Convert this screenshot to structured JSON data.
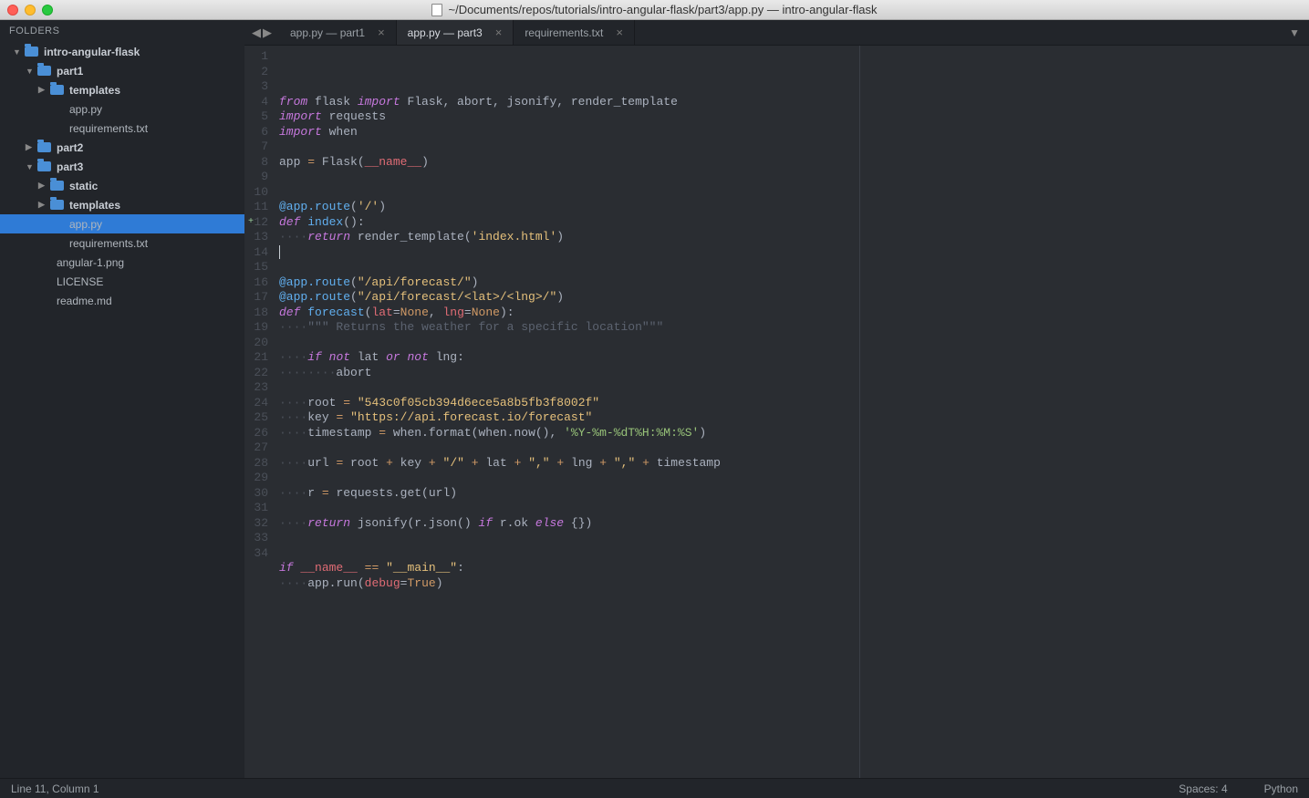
{
  "window": {
    "title": "~/Documents/repos/tutorials/intro-angular-flask/part3/app.py — intro-angular-flask"
  },
  "sidebar": {
    "header": "FOLDERS",
    "tree": [
      {
        "name": "intro-angular-flask",
        "type": "folder",
        "indent": 0,
        "open": true
      },
      {
        "name": "part1",
        "type": "folder",
        "indent": 1,
        "open": true
      },
      {
        "name": "templates",
        "type": "folder",
        "indent": 2,
        "open": false
      },
      {
        "name": "app.py",
        "type": "file",
        "indent": 2
      },
      {
        "name": "requirements.txt",
        "type": "file",
        "indent": 2
      },
      {
        "name": "part2",
        "type": "folder",
        "indent": 1,
        "open": false
      },
      {
        "name": "part3",
        "type": "folder",
        "indent": 1,
        "open": true
      },
      {
        "name": "static",
        "type": "folder",
        "indent": 2,
        "open": false
      },
      {
        "name": "templates",
        "type": "folder",
        "indent": 2,
        "open": false
      },
      {
        "name": "app.py",
        "type": "file",
        "indent": 2,
        "selected": true
      },
      {
        "name": "requirements.txt",
        "type": "file",
        "indent": 2
      },
      {
        "name": "angular-1.png",
        "type": "file",
        "indent": 1
      },
      {
        "name": "LICENSE",
        "type": "file",
        "indent": 1
      },
      {
        "name": "readme.md",
        "type": "file",
        "indent": 1
      }
    ]
  },
  "tabs": [
    {
      "label": "app.py — part1",
      "active": false
    },
    {
      "label": "app.py — part3",
      "active": true
    },
    {
      "label": "requirements.txt",
      "active": false
    }
  ],
  "code": {
    "lines": [
      [
        {
          "t": "from",
          "c": "key"
        },
        {
          "t": " flask "
        },
        {
          "t": "import",
          "c": "key"
        },
        {
          "t": " Flask, abort, jsonify, render_template"
        }
      ],
      [
        {
          "t": "import",
          "c": "key"
        },
        {
          "t": " requests"
        }
      ],
      [
        {
          "t": "import",
          "c": "key"
        },
        {
          "t": " when"
        }
      ],
      [],
      [
        {
          "t": "app "
        },
        {
          "t": "=",
          "c": "op"
        },
        {
          "t": " Flask("
        },
        {
          "t": "__name__",
          "c": "var"
        },
        {
          "t": ")"
        }
      ],
      [],
      [],
      [
        {
          "t": "@app.route",
          "c": "dec"
        },
        {
          "t": "("
        },
        {
          "t": "'/'",
          "c": "str"
        },
        {
          "t": ")"
        }
      ],
      [
        {
          "t": "def",
          "c": "key"
        },
        {
          "t": " "
        },
        {
          "t": "index",
          "c": "def"
        },
        {
          "t": "():"
        }
      ],
      [
        {
          "t": "····",
          "c": "dot"
        },
        {
          "t": "return",
          "c": "key"
        },
        {
          "t": " render_template("
        },
        {
          "t": "'index.html'",
          "c": "str"
        },
        {
          "t": ")"
        }
      ],
      [
        {
          "cursor": true
        }
      ],
      [],
      [
        {
          "t": "@app.route",
          "c": "dec"
        },
        {
          "t": "("
        },
        {
          "t": "\"/api/forecast/\"",
          "c": "str"
        },
        {
          "t": ")"
        }
      ],
      [
        {
          "t": "@app.route",
          "c": "dec"
        },
        {
          "t": "("
        },
        {
          "t": "\"/api/forecast/<lat>/<lng>/\"",
          "c": "str"
        },
        {
          "t": ")"
        }
      ],
      [
        {
          "t": "def",
          "c": "key"
        },
        {
          "t": " "
        },
        {
          "t": "forecast",
          "c": "def"
        },
        {
          "t": "("
        },
        {
          "t": "lat",
          "c": "var"
        },
        {
          "t": "="
        },
        {
          "t": "None",
          "c": "num"
        },
        {
          "t": ", "
        },
        {
          "t": "lng",
          "c": "var"
        },
        {
          "t": "="
        },
        {
          "t": "None",
          "c": "num"
        },
        {
          "t": "):"
        }
      ],
      [
        {
          "t": "····",
          "c": "dot"
        },
        {
          "t": "\"\"\" Returns the weather for a specific location\"\"\"",
          "c": "cmt"
        }
      ],
      [],
      [
        {
          "t": "····",
          "c": "dot"
        },
        {
          "t": "if",
          "c": "key"
        },
        {
          "t": " "
        },
        {
          "t": "not",
          "c": "key"
        },
        {
          "t": " lat "
        },
        {
          "t": "or",
          "c": "key"
        },
        {
          "t": " "
        },
        {
          "t": "not",
          "c": "key"
        },
        {
          "t": " lng:"
        }
      ],
      [
        {
          "t": "········",
          "c": "dot"
        },
        {
          "t": "abort"
        }
      ],
      [],
      [
        {
          "t": "····",
          "c": "dot"
        },
        {
          "t": "root "
        },
        {
          "t": "=",
          "c": "op"
        },
        {
          "t": " "
        },
        {
          "t": "\"543c0f05cb394d6ece5a8b5fb3f8002f\"",
          "c": "str"
        }
      ],
      [
        {
          "t": "····",
          "c": "dot"
        },
        {
          "t": "key "
        },
        {
          "t": "=",
          "c": "op"
        },
        {
          "t": " "
        },
        {
          "t": "\"https://api.forecast.io/forecast\"",
          "c": "str"
        }
      ],
      [
        {
          "t": "····",
          "c": "dot"
        },
        {
          "t": "timestamp "
        },
        {
          "t": "=",
          "c": "op"
        },
        {
          "t": " when.format(when.now(), "
        },
        {
          "t": "'%Y-%m-%dT%H:%M:%S'",
          "c": "str2"
        },
        {
          "t": ")"
        }
      ],
      [],
      [
        {
          "t": "····",
          "c": "dot"
        },
        {
          "t": "url "
        },
        {
          "t": "=",
          "c": "op"
        },
        {
          "t": " root "
        },
        {
          "t": "+",
          "c": "op"
        },
        {
          "t": " key "
        },
        {
          "t": "+",
          "c": "op"
        },
        {
          "t": " "
        },
        {
          "t": "\"/\"",
          "c": "str"
        },
        {
          "t": " "
        },
        {
          "t": "+",
          "c": "op"
        },
        {
          "t": " lat "
        },
        {
          "t": "+",
          "c": "op"
        },
        {
          "t": " "
        },
        {
          "t": "\",\"",
          "c": "str"
        },
        {
          "t": " "
        },
        {
          "t": "+",
          "c": "op"
        },
        {
          "t": " lng "
        },
        {
          "t": "+",
          "c": "op"
        },
        {
          "t": " "
        },
        {
          "t": "\",\"",
          "c": "str"
        },
        {
          "t": " "
        },
        {
          "t": "+",
          "c": "op"
        },
        {
          "t": " timestamp"
        }
      ],
      [],
      [
        {
          "t": "····",
          "c": "dot"
        },
        {
          "t": "r "
        },
        {
          "t": "=",
          "c": "op"
        },
        {
          "t": " requests.get(url)"
        }
      ],
      [],
      [
        {
          "t": "····",
          "c": "dot"
        },
        {
          "t": "return",
          "c": "key"
        },
        {
          "t": " jsonify(r.json() "
        },
        {
          "t": "if",
          "c": "key"
        },
        {
          "t": " r.ok "
        },
        {
          "t": "else",
          "c": "key"
        },
        {
          "t": " {})"
        }
      ],
      [],
      [],
      [
        {
          "t": "if",
          "c": "key"
        },
        {
          "t": " "
        },
        {
          "t": "__name__",
          "c": "var"
        },
        {
          "t": " "
        },
        {
          "t": "==",
          "c": "op"
        },
        {
          "t": " "
        },
        {
          "t": "\"__main__\"",
          "c": "str"
        },
        {
          "t": ":"
        }
      ],
      [
        {
          "t": "····",
          "c": "dot"
        },
        {
          "t": "app.run("
        },
        {
          "t": "debug",
          "c": "var"
        },
        {
          "t": "="
        },
        {
          "t": "True",
          "c": "num"
        },
        {
          "t": ")"
        }
      ],
      []
    ],
    "marked_line": 12
  },
  "statusbar": {
    "left": "Line 11, Column 1",
    "spaces": "Spaces: 4",
    "lang": "Python"
  }
}
